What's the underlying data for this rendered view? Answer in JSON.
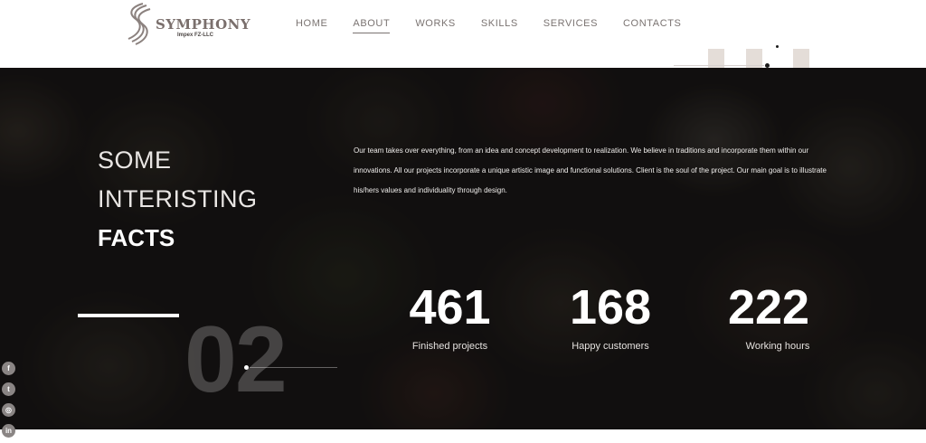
{
  "brand": {
    "name": "SYMPHONY",
    "subtitle": "Impex FZ-LLC",
    "logo_color": "#7a6f6c"
  },
  "nav": {
    "items": [
      {
        "label": "HOME",
        "active": false
      },
      {
        "label": "ABOUT",
        "active": true
      },
      {
        "label": "WORKS",
        "active": false
      },
      {
        "label": "SKILLS",
        "active": false
      },
      {
        "label": "SERVICES",
        "active": false
      },
      {
        "label": "CONTACTS",
        "active": false
      }
    ]
  },
  "facts": {
    "heading": {
      "line1": "SOME",
      "line2": "INTERISTING",
      "line3": "FACTS"
    },
    "description": "Our team takes over everything, from an idea and concept development to realization. We believe in traditions and incorporate them within our innovations. All our projects incorporate a unique artistic image and functional solutions. Client is the soul of the project. Our main goal is to illustrate his/hers values and individuality through design.",
    "section_number": "02",
    "stats": [
      {
        "value": "461",
        "label": "Finished projects"
      },
      {
        "value": "168",
        "label": "Happy customers"
      },
      {
        "value": "222",
        "label": "Working hours"
      }
    ]
  },
  "social": [
    {
      "icon": "facebook-icon",
      "glyph": "f"
    },
    {
      "icon": "twitter-icon",
      "glyph": "t"
    },
    {
      "icon": "instagram-icon",
      "glyph": "◎"
    },
    {
      "icon": "linkedin-icon",
      "glyph": "in"
    }
  ],
  "colors": {
    "dark_bg": "#1b1817",
    "nav_text": "#7a7371",
    "accent_beige": "#e4ddd8"
  }
}
